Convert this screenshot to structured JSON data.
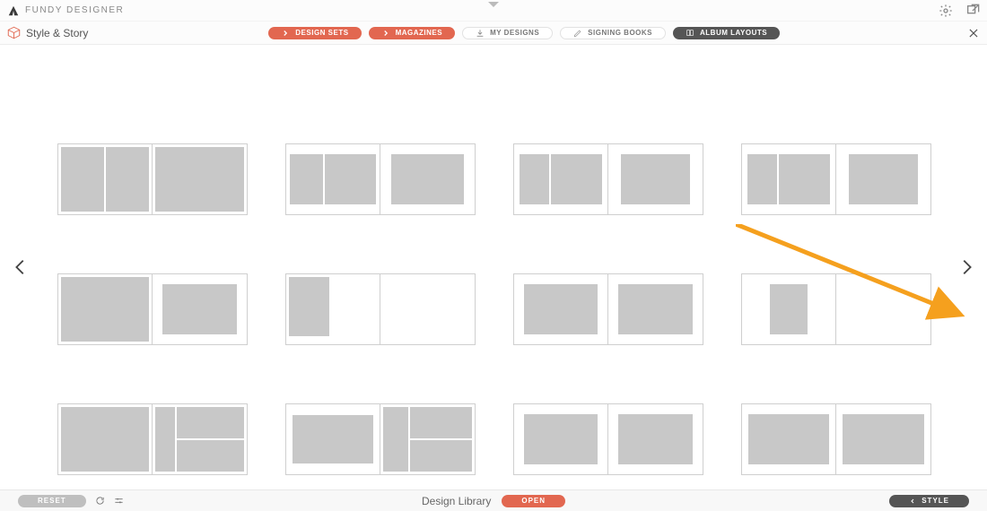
{
  "titlebar": {
    "app_name": "FUNDY DESIGNER"
  },
  "toolbar": {
    "section_label": "Style & Story",
    "buttons": {
      "design_sets": "DESIGN SETS",
      "magazines": "MAGAZINES",
      "my_designs": "MY DESIGNS",
      "signing_books": "SIGNING BOOKS",
      "album_layouts": "ALBUM LAYOUTS"
    }
  },
  "bottombar": {
    "reset": "RESET",
    "center_label": "Design Library",
    "open": "OPEN",
    "style": "STYLE"
  },
  "icons": {
    "logo": "fundy-logo",
    "settings": "settings-icon",
    "external": "open-external-icon",
    "box": "package-icon",
    "chevron_right": "chevron-right-icon",
    "download": "download-icon",
    "pen": "pen-icon",
    "book": "book-icon",
    "close": "close-icon",
    "refresh": "refresh-icon",
    "options": "options-icon",
    "chevron_left_small": "chevron-left-small-icon"
  },
  "colors": {
    "accent": "#e26750",
    "dark": "#555555",
    "grey": "#bfbfbf"
  }
}
